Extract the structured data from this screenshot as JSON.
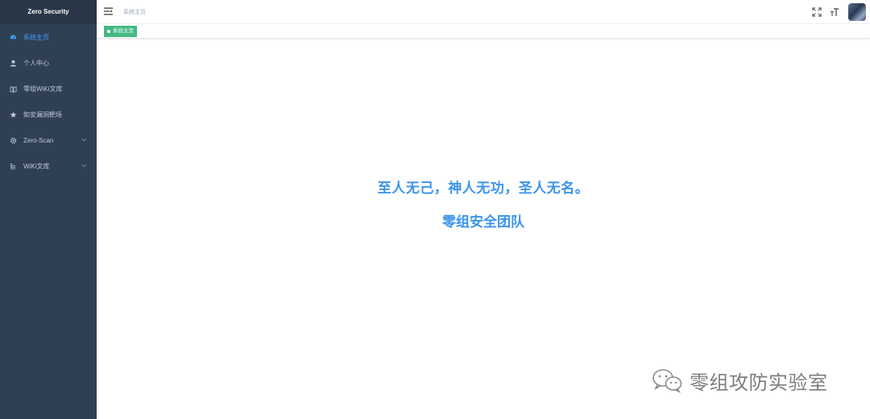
{
  "app": {
    "logo": "Zero Security"
  },
  "sidebar": {
    "items": [
      {
        "label": "系统主页",
        "icon": "dashboard-icon",
        "active": true
      },
      {
        "label": "个人中心",
        "icon": "user-icon"
      },
      {
        "label": "零组WiKi文库",
        "icon": "book-icon"
      },
      {
        "label": "知安漏洞靶场",
        "icon": "star-icon"
      },
      {
        "label": "Zero-Scan",
        "icon": "gear-icon",
        "expandable": true
      },
      {
        "label": "WiKi文库",
        "icon": "tree-icon",
        "expandable": true
      }
    ]
  },
  "header": {
    "breadcrumb": "系统主页",
    "icons": [
      "fullscreen-icon",
      "font-size-icon"
    ]
  },
  "tags": [
    {
      "label": "系统主页",
      "active": true
    }
  ],
  "main": {
    "line1": "至人无己，神人无功，圣人无名。",
    "line2": "零组安全团队"
  },
  "watermark": {
    "text": "零组攻防实验室",
    "icon": "wechat-icon"
  },
  "colors": {
    "sidebar_bg": "#2f4055",
    "accent": "#409eff",
    "tag_green": "#42b983",
    "headline": "#3c95ea"
  }
}
